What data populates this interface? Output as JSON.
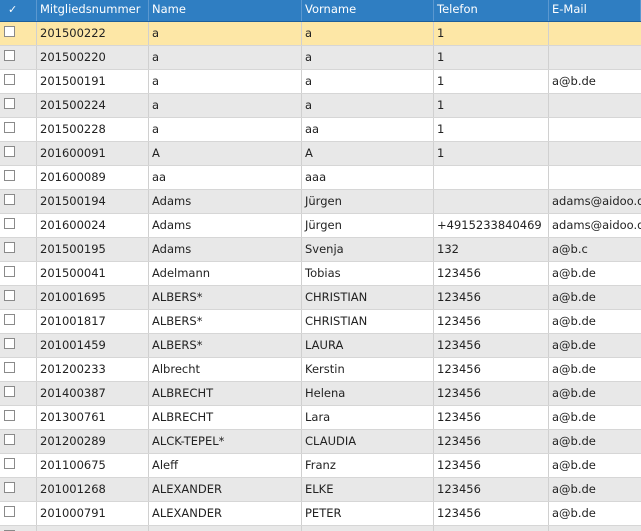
{
  "columns": [
    "",
    "Mitgliedsnummer",
    "Name",
    "Vorname",
    "Telefon",
    "E-Mail"
  ],
  "header_check_glyph": "✓",
  "selected_row_index": 0,
  "rows": [
    {
      "nr": "201500222",
      "name": "a",
      "vorname": "a",
      "telefon": "1",
      "email": ""
    },
    {
      "nr": "201500220",
      "name": "a",
      "vorname": "a",
      "telefon": "1",
      "email": ""
    },
    {
      "nr": "201500191",
      "name": "a",
      "vorname": "a",
      "telefon": "1",
      "email": "a@b.de"
    },
    {
      "nr": "201500224",
      "name": "a",
      "vorname": "a",
      "telefon": "1",
      "email": ""
    },
    {
      "nr": "201500228",
      "name": "a",
      "vorname": "aa",
      "telefon": "1",
      "email": ""
    },
    {
      "nr": "201600091",
      "name": "A",
      "vorname": "A",
      "telefon": "1",
      "email": ""
    },
    {
      "nr": "201600089",
      "name": "aa",
      "vorname": "aaa",
      "telefon": "",
      "email": ""
    },
    {
      "nr": "201500194",
      "name": "Adams",
      "vorname": "Jürgen",
      "telefon": "",
      "email": "adams@aidoo.de"
    },
    {
      "nr": "201600024",
      "name": "Adams",
      "vorname": "Jürgen",
      "telefon": "+4915233840469",
      "email": "adams@aidoo.de"
    },
    {
      "nr": "201500195",
      "name": "Adams",
      "vorname": "Svenja",
      "telefon": "132",
      "email": "a@b.c"
    },
    {
      "nr": "201500041",
      "name": "Adelmann",
      "vorname": "Tobias",
      "telefon": "123456",
      "email": "a@b.de"
    },
    {
      "nr": "201001695",
      "name": "ALBERS*",
      "vorname": "CHRISTIAN",
      "telefon": "123456",
      "email": "a@b.de"
    },
    {
      "nr": "201001817",
      "name": "ALBERS*",
      "vorname": "CHRISTIAN",
      "telefon": "123456",
      "email": "a@b.de"
    },
    {
      "nr": "201001459",
      "name": "ALBERS*",
      "vorname": "LAURA",
      "telefon": "123456",
      "email": "a@b.de"
    },
    {
      "nr": "201200233",
      "name": "Albrecht",
      "vorname": "Kerstin",
      "telefon": "123456",
      "email": "a@b.de"
    },
    {
      "nr": "201400387",
      "name": "ALBRECHT",
      "vorname": "Helena",
      "telefon": "123456",
      "email": "a@b.de"
    },
    {
      "nr": "201300761",
      "name": "ALBRECHT",
      "vorname": "Lara",
      "telefon": "123456",
      "email": "a@b.de"
    },
    {
      "nr": "201200289",
      "name": "ALCK-TEPEL*",
      "vorname": "CLAUDIA",
      "telefon": "123456",
      "email": "a@b.de"
    },
    {
      "nr": "201100675",
      "name": "Aleff",
      "vorname": "Franz",
      "telefon": "123456",
      "email": "a@b.de"
    },
    {
      "nr": "201001268",
      "name": "ALEXANDER",
      "vorname": "ELKE",
      "telefon": "123456",
      "email": "a@b.de"
    },
    {
      "nr": "201000791",
      "name": "ALEXANDER",
      "vorname": "PETER",
      "telefon": "123456",
      "email": "a@b.de"
    },
    {
      "nr": "",
      "name": "",
      "vorname": "",
      "telefon": "",
      "email": ""
    }
  ]
}
